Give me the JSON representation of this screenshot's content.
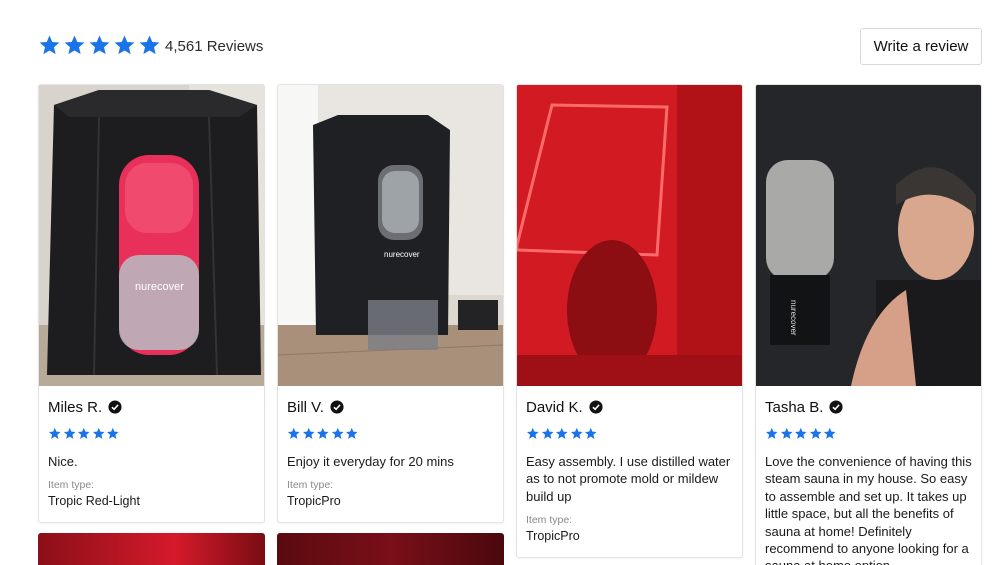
{
  "summary": {
    "rating": 5,
    "reviews_label": "4,561 Reviews",
    "write_review_label": "Write a review",
    "star_color": "#1a73e8"
  },
  "item_type_label": "Item type:",
  "reviews": [
    {
      "name": "Miles R.",
      "rating": 5,
      "text": "Nice.",
      "item_type": "Tropic Red-Light",
      "photo": "black tent sauna with red lit window"
    },
    {
      "name": "Bill V.",
      "rating": 5,
      "text": "Enjoy it everyday for 20 mins",
      "item_type": "TropicPro",
      "photo": "black sauna tent in room with folding chair"
    },
    {
      "name": "David K.",
      "rating": 5,
      "text": "Easy assembly. I use distilled water as to not promote mold or mildew build up",
      "item_type": "TropicPro",
      "photo": "red lit interior of sauna"
    },
    {
      "name": "Tasha B.",
      "rating": 5,
      "text": "Love the convenience of having this steam sauna in my house. So easy to assemble and set up. It takes up little space, but all the benefits of sauna at home! Definitely recommend to anyone looking for a sauna at home option.",
      "item_type": "",
      "photo": "selfie next to sauna tent"
    }
  ]
}
